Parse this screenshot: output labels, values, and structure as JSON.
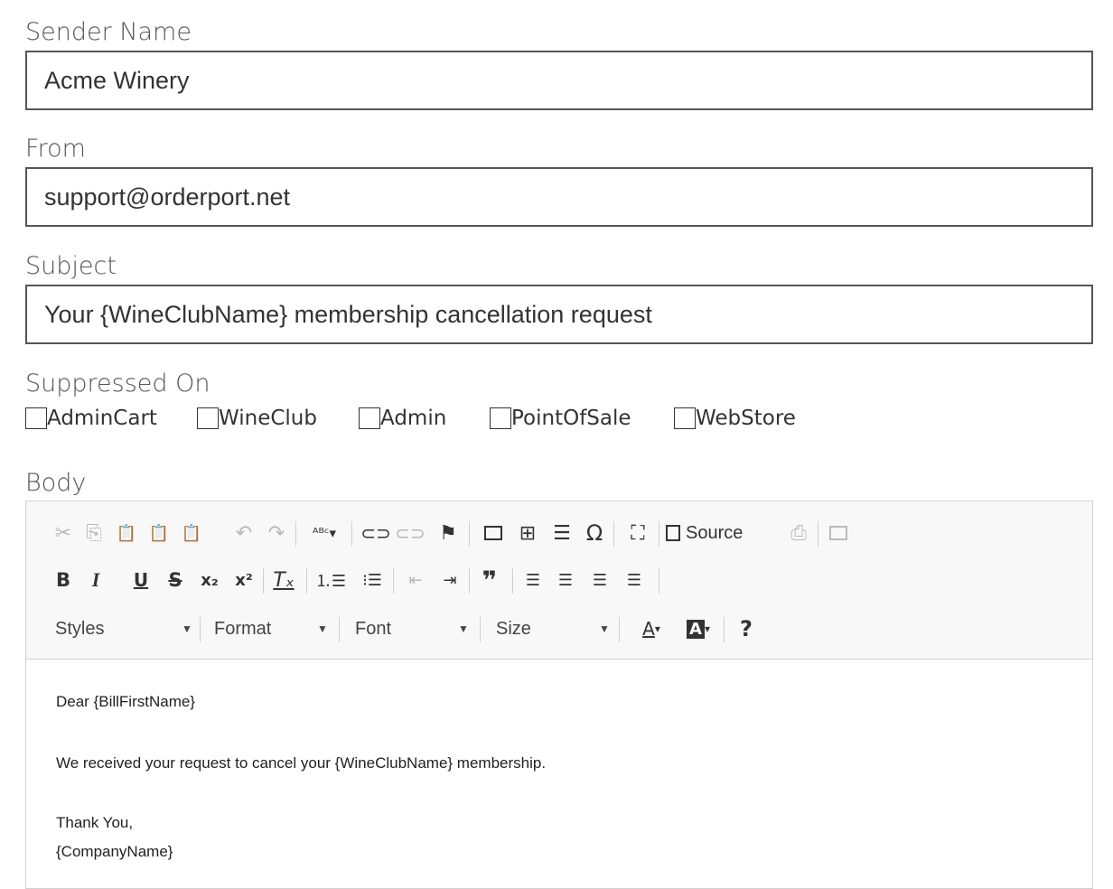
{
  "sender_name": {
    "label": "Sender Name",
    "value": "Acme Winery"
  },
  "from": {
    "label": "From",
    "value": "support@orderport.net"
  },
  "subject": {
    "label": "Subject",
    "value": "Your {WineClubName} membership cancellation request"
  },
  "suppressed_on": {
    "label": "Suppressed On",
    "options": [
      {
        "label": "AdminCart",
        "checked": false
      },
      {
        "label": "WineClub",
        "checked": false
      },
      {
        "label": "Admin",
        "checked": false
      },
      {
        "label": "PointOfSale",
        "checked": false
      },
      {
        "label": "WebStore",
        "checked": false
      }
    ]
  },
  "body": {
    "label": "Body",
    "toolbar": {
      "source_label": "Source",
      "styles_label": "Styles",
      "format_label": "Format",
      "font_label": "Font",
      "size_label": "Size",
      "text_color_glyph": "A",
      "bg_color_glyph": "A",
      "help_glyph": "?"
    },
    "content": {
      "line1": "Dear {BillFirstName}",
      "line2": "We received your request to cancel your {WineClubName} membership.",
      "line3": "Thank You,",
      "line4": "{CompanyName}"
    }
  }
}
